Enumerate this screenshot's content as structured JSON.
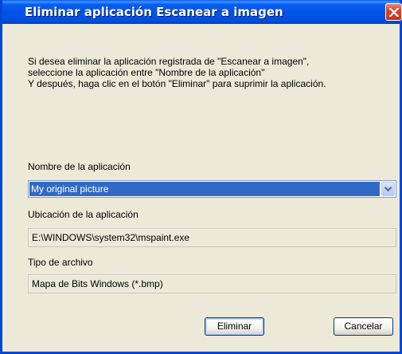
{
  "window": {
    "title": "Eliminar aplicación Escanear a imagen"
  },
  "message": {
    "line1": "Si desea eliminar la aplicación registrada de \"Escanear a imagen\",",
    "line2": "seleccione  la aplicación entre \"Nombre de la aplicación\"",
    "line3": "Y después, haga clic en el botón \"Eliminar\" para suprimir la aplicación."
  },
  "app_name": {
    "label": "Nombre de la aplicación",
    "selected_value": "My original picture"
  },
  "app_location": {
    "label": "Ubicación de la aplicación",
    "value": "E:\\WINDOWS\\system32\\mspaint.exe"
  },
  "file_type": {
    "label": "Tipo de archivo",
    "value": "Mapa de Bits Windows (*.bmp)"
  },
  "buttons": {
    "delete_label": "Eliminar",
    "cancel_label": "Cancelar"
  },
  "icons": {
    "close": "close-icon",
    "dropdown": "chevron-down-icon"
  },
  "colors": {
    "titlebar": "#0153e6",
    "selection": "#316ac5",
    "close_button": "#d9462c",
    "dialog_background": "#ece9d8"
  }
}
